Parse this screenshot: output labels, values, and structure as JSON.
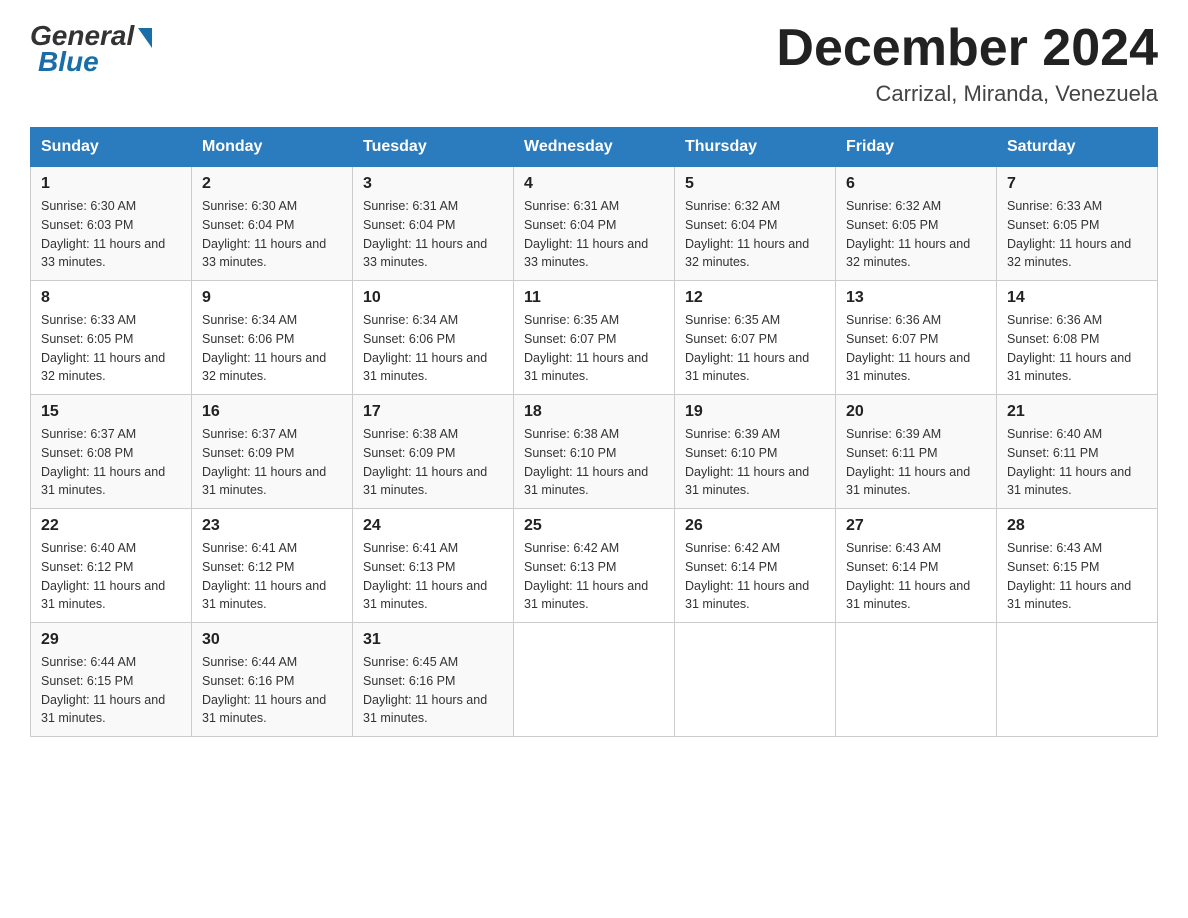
{
  "logo": {
    "general_text": "General",
    "blue_text": "Blue",
    "bottom_text": "Blue"
  },
  "header": {
    "month_year": "December 2024",
    "location": "Carrizal, Miranda, Venezuela"
  },
  "days_of_week": [
    "Sunday",
    "Monday",
    "Tuesday",
    "Wednesday",
    "Thursday",
    "Friday",
    "Saturday"
  ],
  "weeks": [
    [
      {
        "day": "1",
        "sunrise": "6:30 AM",
        "sunset": "6:03 PM",
        "daylight": "11 hours and 33 minutes."
      },
      {
        "day": "2",
        "sunrise": "6:30 AM",
        "sunset": "6:04 PM",
        "daylight": "11 hours and 33 minutes."
      },
      {
        "day": "3",
        "sunrise": "6:31 AM",
        "sunset": "6:04 PM",
        "daylight": "11 hours and 33 minutes."
      },
      {
        "day": "4",
        "sunrise": "6:31 AM",
        "sunset": "6:04 PM",
        "daylight": "11 hours and 33 minutes."
      },
      {
        "day": "5",
        "sunrise": "6:32 AM",
        "sunset": "6:04 PM",
        "daylight": "11 hours and 32 minutes."
      },
      {
        "day": "6",
        "sunrise": "6:32 AM",
        "sunset": "6:05 PM",
        "daylight": "11 hours and 32 minutes."
      },
      {
        "day": "7",
        "sunrise": "6:33 AM",
        "sunset": "6:05 PM",
        "daylight": "11 hours and 32 minutes."
      }
    ],
    [
      {
        "day": "8",
        "sunrise": "6:33 AM",
        "sunset": "6:05 PM",
        "daylight": "11 hours and 32 minutes."
      },
      {
        "day": "9",
        "sunrise": "6:34 AM",
        "sunset": "6:06 PM",
        "daylight": "11 hours and 32 minutes."
      },
      {
        "day": "10",
        "sunrise": "6:34 AM",
        "sunset": "6:06 PM",
        "daylight": "11 hours and 31 minutes."
      },
      {
        "day": "11",
        "sunrise": "6:35 AM",
        "sunset": "6:07 PM",
        "daylight": "11 hours and 31 minutes."
      },
      {
        "day": "12",
        "sunrise": "6:35 AM",
        "sunset": "6:07 PM",
        "daylight": "11 hours and 31 minutes."
      },
      {
        "day": "13",
        "sunrise": "6:36 AM",
        "sunset": "6:07 PM",
        "daylight": "11 hours and 31 minutes."
      },
      {
        "day": "14",
        "sunrise": "6:36 AM",
        "sunset": "6:08 PM",
        "daylight": "11 hours and 31 minutes."
      }
    ],
    [
      {
        "day": "15",
        "sunrise": "6:37 AM",
        "sunset": "6:08 PM",
        "daylight": "11 hours and 31 minutes."
      },
      {
        "day": "16",
        "sunrise": "6:37 AM",
        "sunset": "6:09 PM",
        "daylight": "11 hours and 31 minutes."
      },
      {
        "day": "17",
        "sunrise": "6:38 AM",
        "sunset": "6:09 PM",
        "daylight": "11 hours and 31 minutes."
      },
      {
        "day": "18",
        "sunrise": "6:38 AM",
        "sunset": "6:10 PM",
        "daylight": "11 hours and 31 minutes."
      },
      {
        "day": "19",
        "sunrise": "6:39 AM",
        "sunset": "6:10 PM",
        "daylight": "11 hours and 31 minutes."
      },
      {
        "day": "20",
        "sunrise": "6:39 AM",
        "sunset": "6:11 PM",
        "daylight": "11 hours and 31 minutes."
      },
      {
        "day": "21",
        "sunrise": "6:40 AM",
        "sunset": "6:11 PM",
        "daylight": "11 hours and 31 minutes."
      }
    ],
    [
      {
        "day": "22",
        "sunrise": "6:40 AM",
        "sunset": "6:12 PM",
        "daylight": "11 hours and 31 minutes."
      },
      {
        "day": "23",
        "sunrise": "6:41 AM",
        "sunset": "6:12 PM",
        "daylight": "11 hours and 31 minutes."
      },
      {
        "day": "24",
        "sunrise": "6:41 AM",
        "sunset": "6:13 PM",
        "daylight": "11 hours and 31 minutes."
      },
      {
        "day": "25",
        "sunrise": "6:42 AM",
        "sunset": "6:13 PM",
        "daylight": "11 hours and 31 minutes."
      },
      {
        "day": "26",
        "sunrise": "6:42 AM",
        "sunset": "6:14 PM",
        "daylight": "11 hours and 31 minutes."
      },
      {
        "day": "27",
        "sunrise": "6:43 AM",
        "sunset": "6:14 PM",
        "daylight": "11 hours and 31 minutes."
      },
      {
        "day": "28",
        "sunrise": "6:43 AM",
        "sunset": "6:15 PM",
        "daylight": "11 hours and 31 minutes."
      }
    ],
    [
      {
        "day": "29",
        "sunrise": "6:44 AM",
        "sunset": "6:15 PM",
        "daylight": "11 hours and 31 minutes."
      },
      {
        "day": "30",
        "sunrise": "6:44 AM",
        "sunset": "6:16 PM",
        "daylight": "11 hours and 31 minutes."
      },
      {
        "day": "31",
        "sunrise": "6:45 AM",
        "sunset": "6:16 PM",
        "daylight": "11 hours and 31 minutes."
      },
      null,
      null,
      null,
      null
    ]
  ]
}
